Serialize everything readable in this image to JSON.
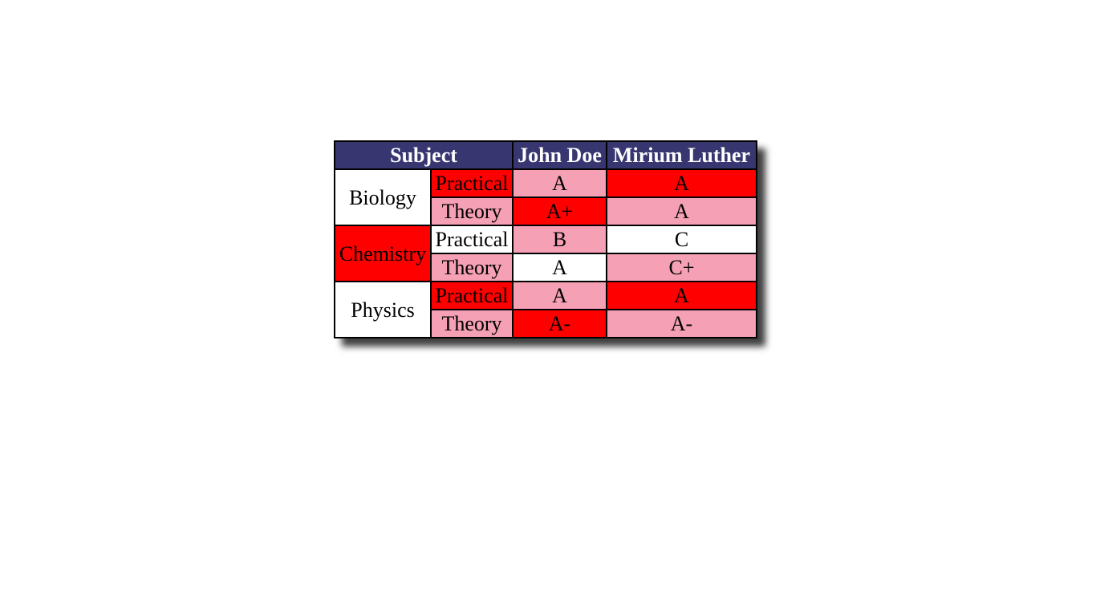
{
  "header": {
    "subject": "Subject",
    "student_1": "John Doe",
    "student_2": "Mirium Luther"
  },
  "colors": {
    "header_bg": "#373670",
    "red": "#ff0000",
    "pink": "#f5a0b5",
    "white": "#ffffff"
  },
  "rows": [
    {
      "subject": "Biology",
      "subject_color": "white",
      "parts": [
        {
          "type": "Practical",
          "type_color": "red",
          "john": "A",
          "john_color": "pink",
          "mirium": "A",
          "mirium_color": "red"
        },
        {
          "type": "Theory",
          "type_color": "pink",
          "john": "A+",
          "john_color": "red",
          "mirium": "A",
          "mirium_color": "pink"
        }
      ]
    },
    {
      "subject": "Chemistry",
      "subject_color": "red",
      "parts": [
        {
          "type": "Practical",
          "type_color": "white",
          "john": "B",
          "john_color": "pink",
          "mirium": "C",
          "mirium_color": "white"
        },
        {
          "type": "Theory",
          "type_color": "pink",
          "john": "A",
          "john_color": "white",
          "mirium": "C+",
          "mirium_color": "pink"
        }
      ]
    },
    {
      "subject": "Physics",
      "subject_color": "white",
      "parts": [
        {
          "type": "Practical",
          "type_color": "red",
          "john": "A",
          "john_color": "pink",
          "mirium": "A",
          "mirium_color": "red"
        },
        {
          "type": "Theory",
          "type_color": "pink",
          "john": "A-",
          "john_color": "red",
          "mirium": "A-",
          "mirium_color": "pink"
        }
      ]
    }
  ]
}
